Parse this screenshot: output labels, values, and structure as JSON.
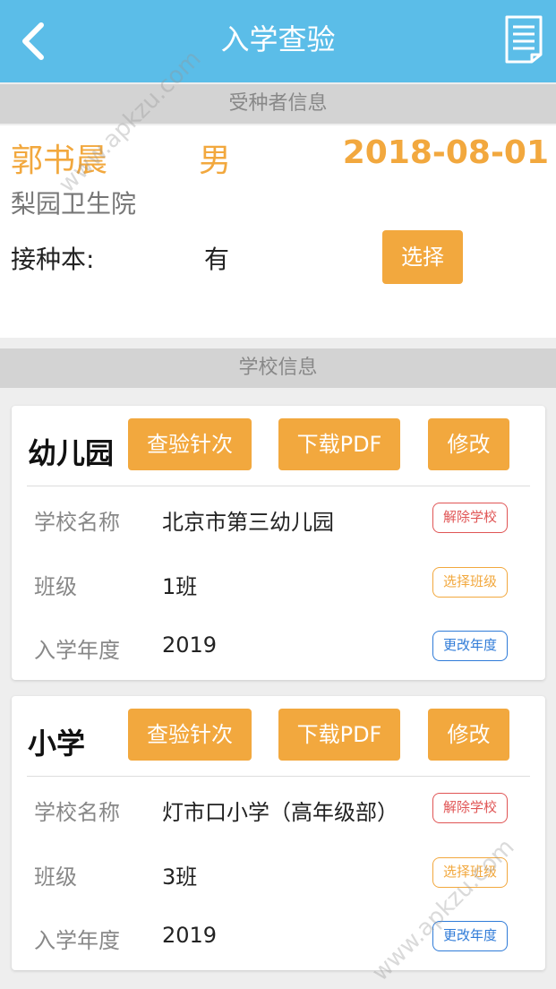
{
  "header": {
    "title": "入学查验"
  },
  "vaccinee": {
    "section_title": "受种者信息",
    "name": "郭书晨",
    "sex": "男",
    "birth_date": "2018-08-01",
    "hospital": "梨园卫生院",
    "book_label": "接种本:",
    "book_value": "有",
    "select_label": "选择"
  },
  "school_section_title": "学校信息",
  "schools": [
    {
      "title": "幼儿园",
      "buttons": [
        "查验针次",
        "下载PDF",
        "修改"
      ],
      "rows": [
        {
          "label": "学校名称",
          "value": "北京市第三幼儿园",
          "tag": "解除学校"
        },
        {
          "label": "班级",
          "value": "1班",
          "tag": "选择班级"
        },
        {
          "label": "入学年度",
          "value": "2019",
          "tag": "更改年度"
        }
      ]
    },
    {
      "title": "小学",
      "buttons": [
        "查验针次",
        "下载PDF",
        "修改"
      ],
      "rows": [
        {
          "label": "学校名称",
          "value": "灯市口小学（高年级部）",
          "tag": "解除学校"
        },
        {
          "label": "班级",
          "value": "3班",
          "tag": "选择班级"
        },
        {
          "label": "入学年度",
          "value": "2019",
          "tag": "更改年度"
        }
      ]
    }
  ],
  "watermarks": [
    "www.apkzu.com",
    "www.apkzu.com"
  ],
  "colors": {
    "header": "#5bbde8",
    "accent": "#f2a83e",
    "danger": "#e05555",
    "link": "#2f7bd8"
  },
  "icons": {
    "back": "chevron-left-icon",
    "document": "document-icon"
  }
}
